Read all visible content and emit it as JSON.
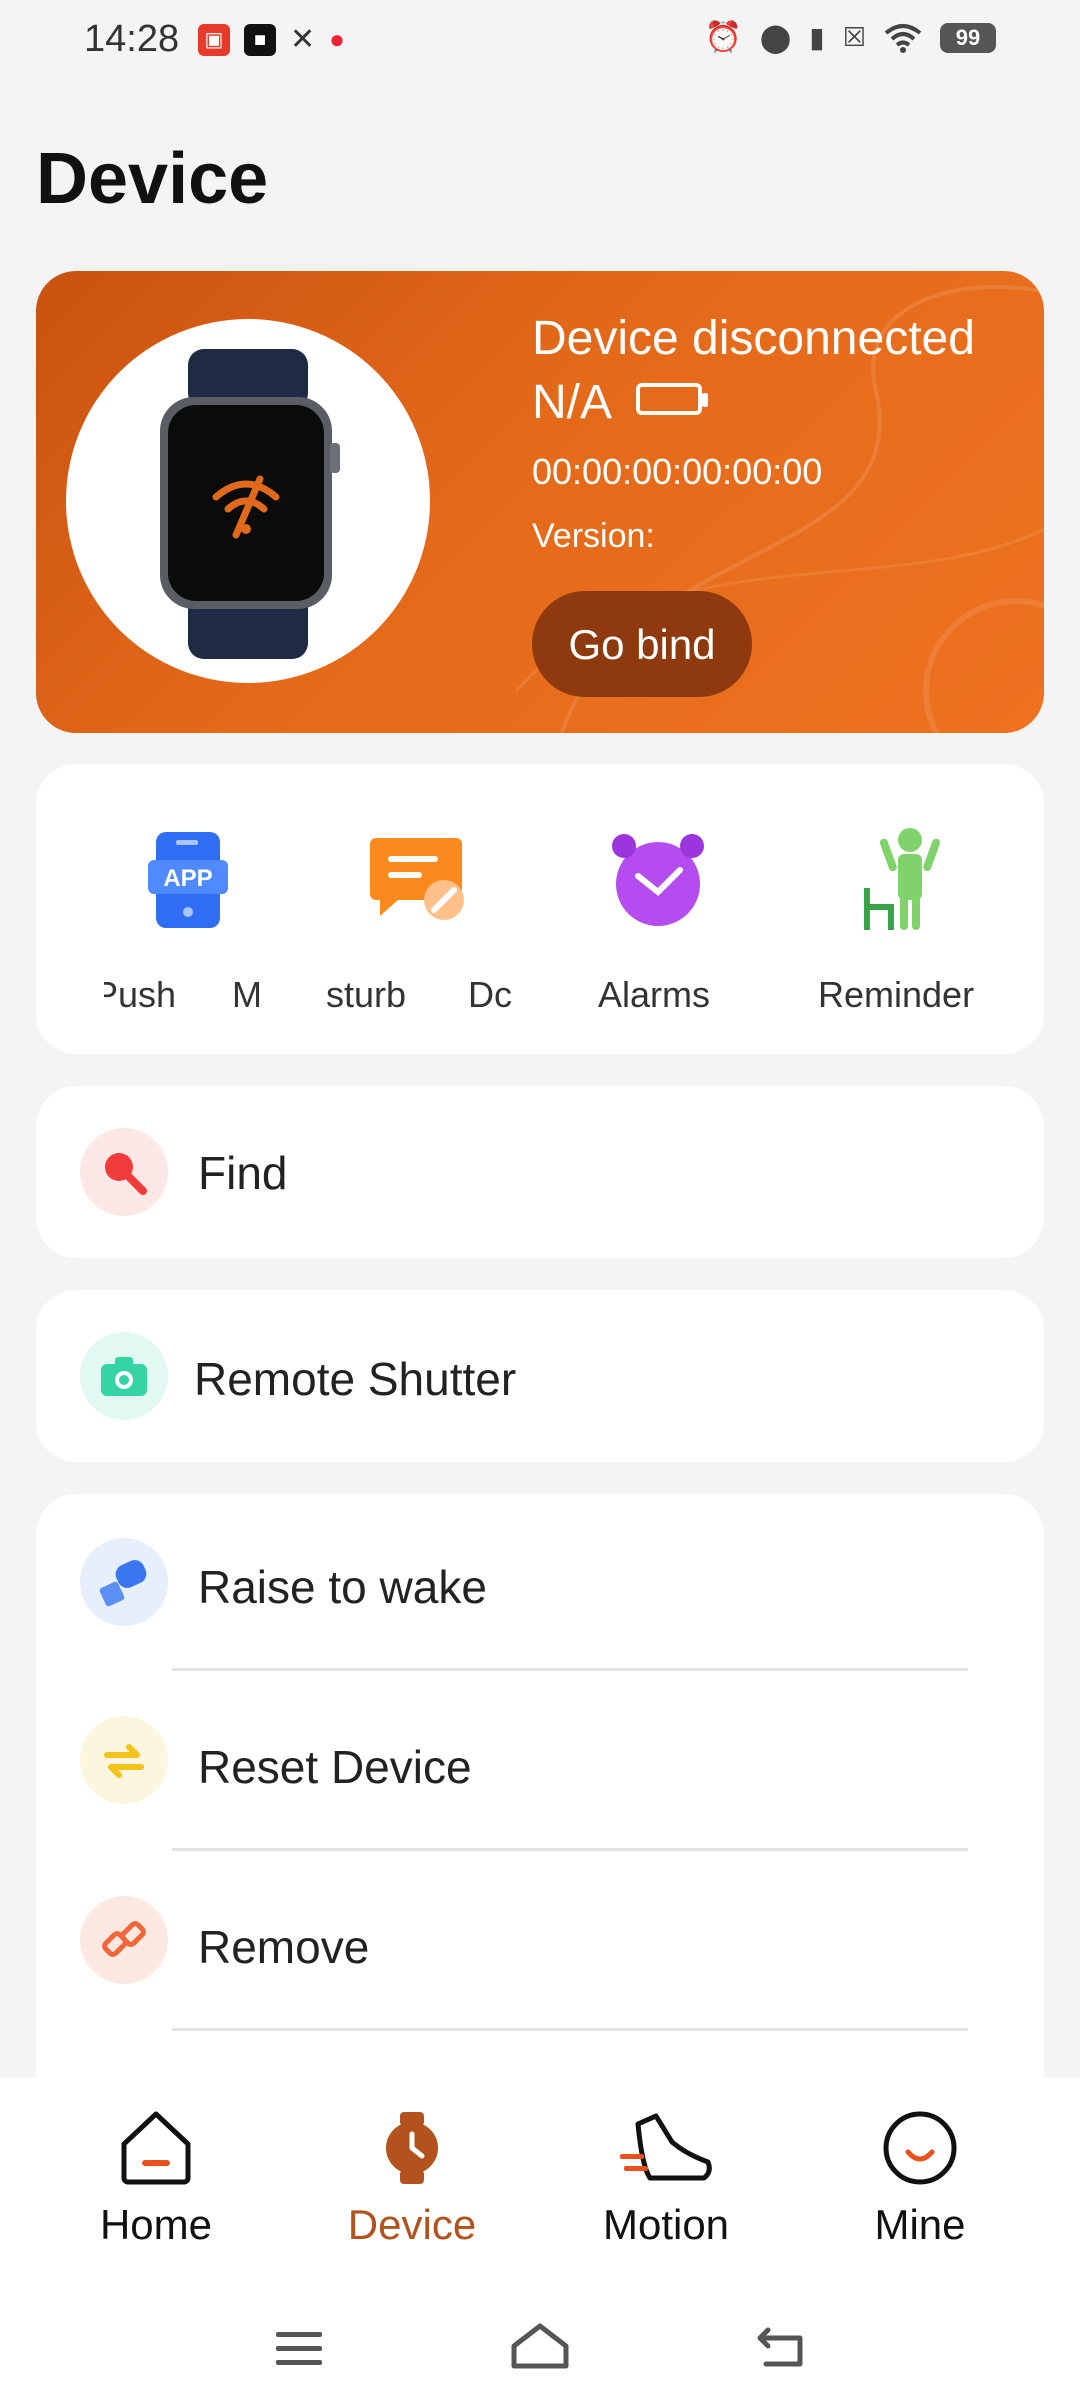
{
  "status_bar": {
    "time": "14:28",
    "battery": "99",
    "left_icons": [
      "news-app-icon",
      "app-icon",
      "tools-icon",
      "location-pin-icon"
    ],
    "right_icons": [
      "alarm-icon",
      "location-icon",
      "vibrate-icon",
      "no-sim-icon",
      "wifi-icon",
      "battery-icon"
    ]
  },
  "page": {
    "title": "Device"
  },
  "device_card": {
    "status": "Device disconnected",
    "battery_text": "N/A",
    "mac": "00:00:00:00:00:00",
    "version_label": "Version:",
    "bind_button": "Go bind",
    "colors": {
      "gradient_start": "#c9520f",
      "gradient_end": "#ee7220",
      "button": "#8f3a0e"
    }
  },
  "shortcuts": [
    {
      "label": "Push",
      "clipped_text": "M",
      "icon": "app-push-icon"
    },
    {
      "label": "sturb",
      "clipped_text": "Dc",
      "icon": "do-not-disturb-icon"
    },
    {
      "label": "Alarms",
      "icon": "alarm-clock-icon"
    },
    {
      "label": "Reminder",
      "icon": "sedentary-reminder-icon"
    }
  ],
  "list": {
    "find": {
      "label": "Find",
      "icon": "search-icon"
    },
    "remote_shutter": {
      "label": "Remote Shutter",
      "icon": "camera-icon"
    },
    "settings": [
      {
        "label": "Raise to wake",
        "icon": "raise-wrist-icon"
      },
      {
        "label": "Reset Device",
        "icon": "reset-icon"
      },
      {
        "label": "Remove",
        "icon": "remove-link-icon"
      }
    ]
  },
  "bottom_nav": [
    {
      "label": "Home",
      "icon": "home-icon",
      "active": false
    },
    {
      "label": "Device",
      "icon": "watch-icon",
      "active": true
    },
    {
      "label": "Motion",
      "icon": "sneaker-icon",
      "active": false
    },
    {
      "label": "Mine",
      "icon": "profile-icon",
      "active": false
    }
  ],
  "system_nav": [
    "menu-icon",
    "home-key-icon",
    "back-icon"
  ],
  "colors": {
    "accent": "#b2521c",
    "background": "#f4f4f4"
  }
}
